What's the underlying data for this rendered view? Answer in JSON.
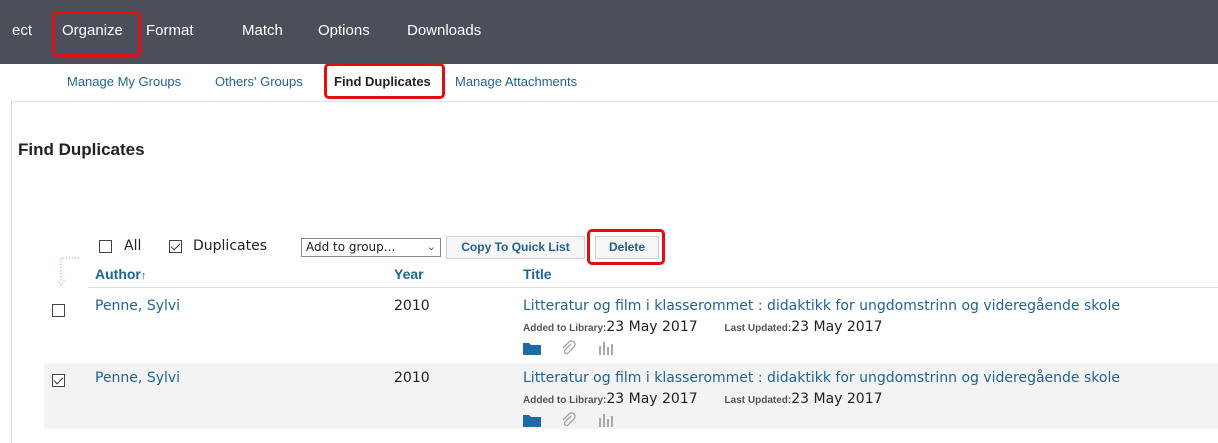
{
  "topnav": {
    "items": [
      "ect",
      "Organize",
      "Format",
      "Match",
      "Options",
      "Downloads"
    ],
    "highlighted": "Organize"
  },
  "subnav": {
    "items": [
      "Manage My Groups",
      "Others' Groups",
      "Find Duplicates",
      "Manage Attachments"
    ],
    "active": "Find Duplicates"
  },
  "page": {
    "title": "Find Duplicates"
  },
  "toolbar": {
    "all_label": "All",
    "all_checked": false,
    "duplicates_label": "Duplicates",
    "duplicates_checked": true,
    "group_select": "Add to group...",
    "copy_label": "Copy To Quick List",
    "delete_label": "Delete"
  },
  "table": {
    "headers": {
      "author": "Author",
      "author_sort": "↑",
      "year": "Year",
      "title": "Title"
    },
    "rows": [
      {
        "checked": false,
        "author": "Penne, Sylvi",
        "year": "2010",
        "title": "Litteratur og film i klasserommet : didaktikk for ungdomstrinn og videregående skole",
        "added_label": "Added to Library:",
        "added": "23 May 2017",
        "updated_label": "Last Updated:",
        "updated": "23 May 2017",
        "icons": [
          "folder-icon",
          "attachment-icon",
          "bar-chart-icon"
        ]
      },
      {
        "checked": true,
        "author": "Penne, Sylvi",
        "year": "2010",
        "title": "Litteratur og film i klasserommet : didaktikk for ungdomstrinn og videregående skole",
        "added_label": "Added to Library:",
        "added": "23 May 2017",
        "updated_label": "Last Updated:",
        "updated": "23 May 2017",
        "icons": [
          "folder-icon",
          "attachment-icon",
          "bar-chart-icon"
        ]
      }
    ]
  },
  "colors": {
    "highlight": "#e01010",
    "link": "#1f6496",
    "topbar": "#4b4f5a"
  }
}
